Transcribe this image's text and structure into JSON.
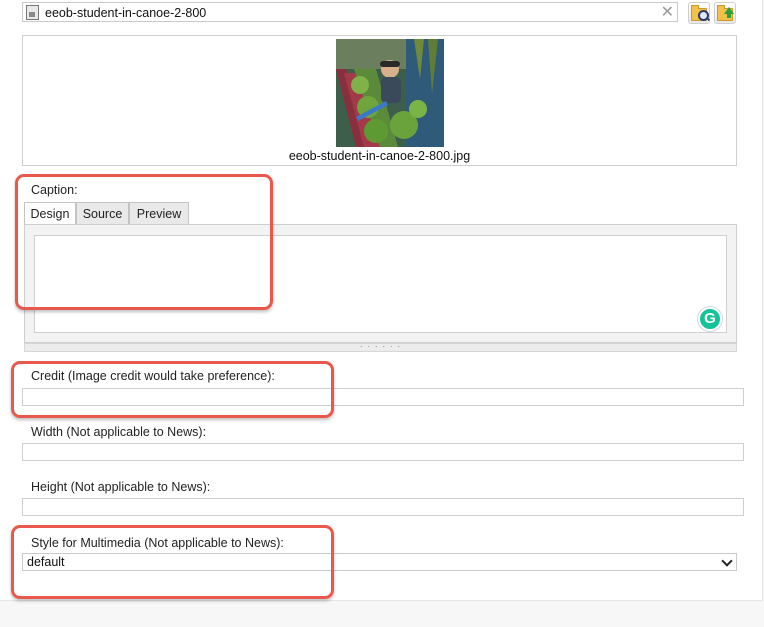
{
  "picker": {
    "value": "eeob-student-in-canoe-2-800",
    "clear_glyph": "✕",
    "browse_icon": "folder-search-icon",
    "upload_icon": "folder-upload-icon"
  },
  "preview": {
    "filename": "eeob-student-in-canoe-2-800.jpg"
  },
  "caption": {
    "label": "Caption:",
    "tabs": [
      "Design",
      "Source",
      "Preview"
    ],
    "active_tab": "Design",
    "content": "",
    "grammarly_glyph": "G",
    "resize_grip": "· · · · · ·"
  },
  "fields": {
    "credit_label": "Credit (Image credit would take preference):",
    "credit_value": "",
    "width_label": "Width (Not applicable to News):",
    "width_value": "",
    "height_label": "Height (Not applicable to News):",
    "height_value": "",
    "style_label": "Style for Multimedia (Not applicable to News):",
    "style_value": "default"
  },
  "colors": {
    "callout": "#e8584c",
    "grammarly": "#15c39a"
  }
}
